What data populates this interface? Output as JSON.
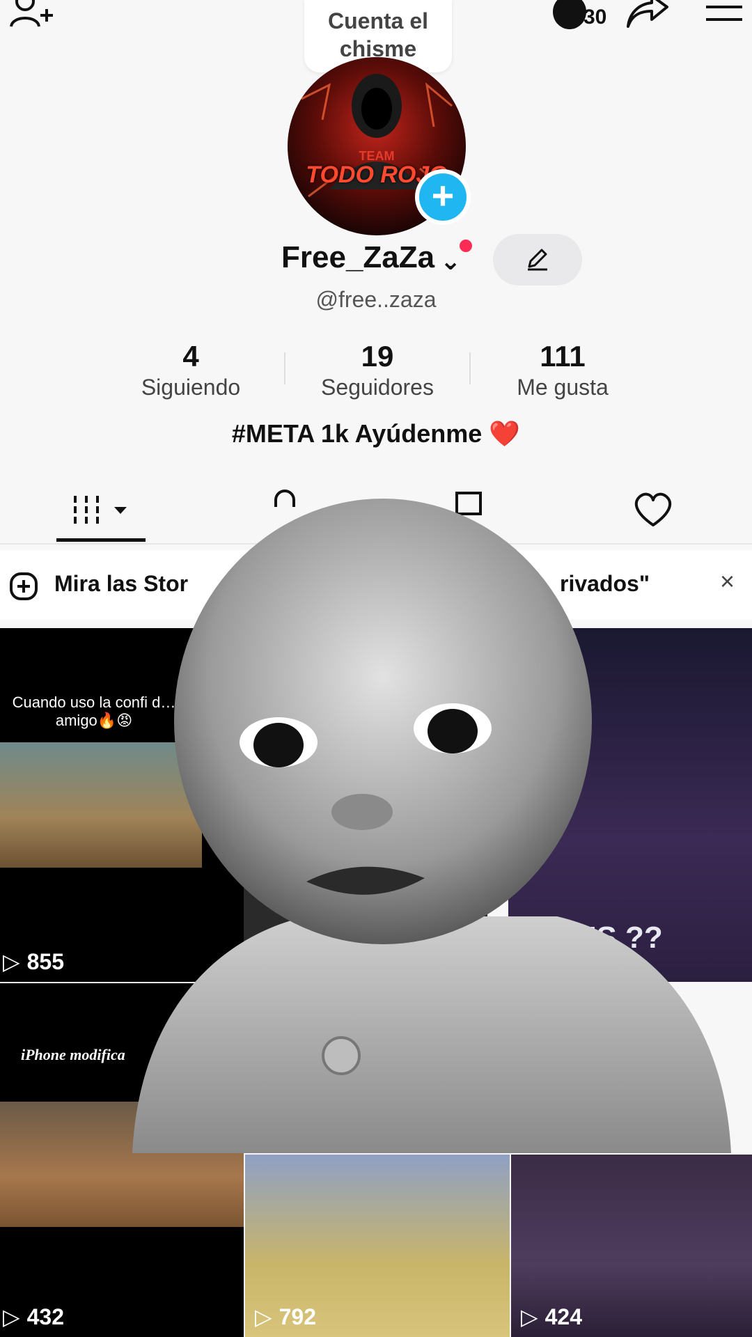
{
  "topbar": {
    "notif_count": "30",
    "bubble_line1": "Cuenta el",
    "bubble_line2": "chisme"
  },
  "profile": {
    "avatar_text_line1": "TEAM",
    "avatar_text_line2": "TODO ROJO",
    "username": "Free_ZaZa",
    "handle": "@free..zaza",
    "stats": [
      {
        "value": "4",
        "label": "Siguiendo"
      },
      {
        "value": "19",
        "label": "Seguidores"
      },
      {
        "value": "111",
        "label": "Me gusta"
      }
    ],
    "bio": "#META 1k Ayúdenme ❤️"
  },
  "banner": {
    "text_left": "Mira las Stor",
    "text_right": "rivados\""
  },
  "videos": [
    {
      "caption": "Cuando uso la confi d… amigo🔥😡",
      "views": "855"
    },
    {
      "caption": "",
      "views": ""
    },
    {
      "caption": "EDES ??",
      "views": ""
    },
    {
      "caption": "iPhone modifica",
      "views": "432"
    },
    {
      "caption": "",
      "views": "792"
    },
    {
      "caption": "",
      "views": "424"
    }
  ],
  "colors": {
    "accent_blue": "#1fb6f1",
    "red_dot": "#fe2c55"
  }
}
